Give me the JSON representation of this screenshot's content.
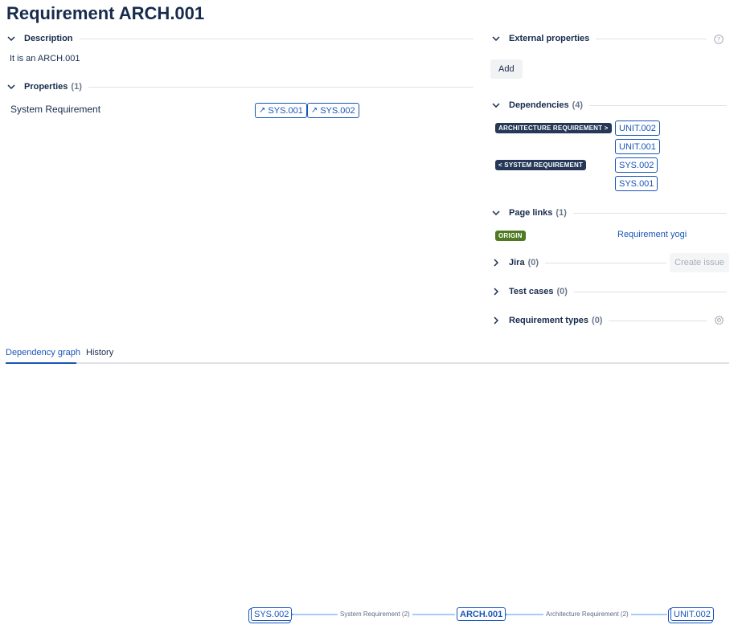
{
  "page": {
    "title": "Requirement ARCH.001"
  },
  "description": {
    "title": "Description",
    "text": "It is an ARCH.001"
  },
  "properties": {
    "title": "Properties",
    "count": "(1)",
    "rows": [
      {
        "name": "System Requirement",
        "links": [
          "SYS.001",
          "SYS.002"
        ]
      }
    ]
  },
  "external_properties": {
    "title": "External properties",
    "add_label": "Add"
  },
  "dependencies": {
    "title": "Dependencies",
    "count": "(4)",
    "groups": [
      {
        "type": "ARCHITECTURE REQUIREMENT >",
        "items": [
          "UNIT.002",
          "UNIT.001"
        ]
      },
      {
        "type": "< SYSTEM REQUIREMENT",
        "items": [
          "SYS.002",
          "SYS.001"
        ]
      }
    ]
  },
  "page_links": {
    "title": "Page links",
    "count": "(1)",
    "items": [
      {
        "badge": "ORIGIN",
        "label": "Requirement yogi"
      }
    ]
  },
  "jira": {
    "title": "Jira",
    "count": "(0)",
    "create_label": "Create issue"
  },
  "test_cases": {
    "title": "Test cases",
    "count": "(0)"
  },
  "requirement_types": {
    "title": "Requirement types",
    "count": "(0)"
  },
  "tabs": [
    {
      "label": "Dependency graph",
      "active": true
    },
    {
      "label": "History",
      "active": false
    }
  ],
  "graph": {
    "left_node": "SYS.002",
    "left_edge": "System Requirement (2)",
    "center_node": "ARCH.001",
    "right_edge": "Architecture Requirement (2)",
    "right_node": "UNIT.002"
  },
  "colors": {
    "link_blue": "#1a56b8",
    "lozenge_dark": "#253858",
    "lozenge_green": "#4f7a21",
    "divider": "#dfe1e6"
  }
}
